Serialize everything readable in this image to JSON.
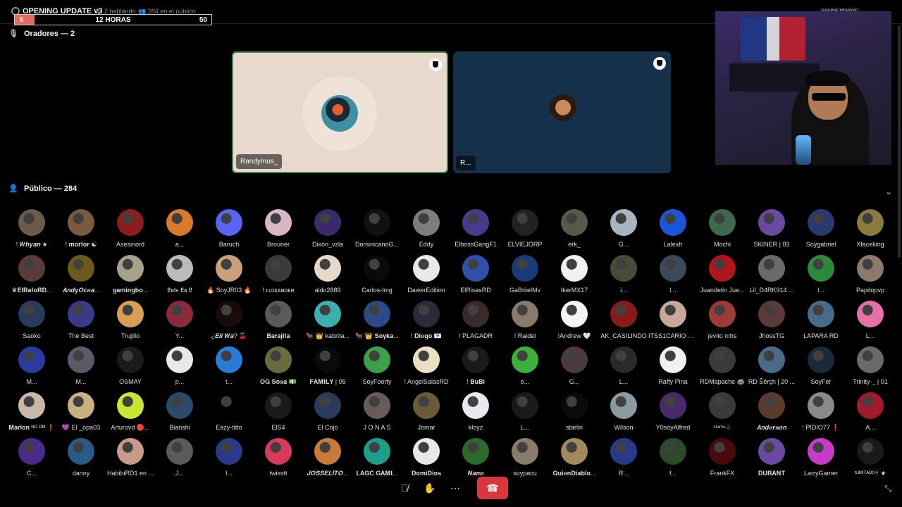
{
  "stage": {
    "title": "OPENING UPDATE v3",
    "speaking": "2 hablando",
    "audience_count_text": "284 en el público",
    "badge": "HABILITADO"
  },
  "timer": {
    "left_value": "5",
    "label": "12 HORAS",
    "right_value": "50",
    "progress": 0.1,
    "fill_color": "#e36a5f"
  },
  "speakers": {
    "heading": "Oradores — 2",
    "cards": [
      {
        "name": "Randymus_",
        "bg": "#e9d8cd"
      },
      {
        "name": "R...",
        "bg": "#15304a"
      }
    ]
  },
  "audience": {
    "heading": "Público — 284",
    "members": [
      {
        "name": "! 𝑾𝒉𝒚𝒂𝒏 ★",
        "color": "#6b5b4a"
      },
      {
        "name": "! 𝐦𝐨𝐫𝐟𝐨𝐫 ☯",
        "color": "#7a5a3c"
      },
      {
        "name": "Asesinord",
        "color": "#8a1d1d"
      },
      {
        "name": "a...",
        "color": "#d97a2b"
      },
      {
        "name": "Baruch",
        "color": "#5865f2"
      },
      {
        "name": "Brouner",
        "color": "#d8b6c8"
      },
      {
        "name": "Dixon_vzla",
        "color": "#3b2a6b"
      },
      {
        "name": "DominicanoG...",
        "color": "#111111"
      },
      {
        "name": "Eddy",
        "color": "#7d7d7d"
      },
      {
        "name": "ElbossGangF1",
        "color": "#4a3a8c"
      },
      {
        "name": "ELVIEJORP",
        "color": "#222222"
      },
      {
        "name": "erk_",
        "color": "#555a4a"
      },
      {
        "name": "G...",
        "color": "#aab4c0"
      },
      {
        "name": "Lalexh",
        "color": "#1a57d8"
      },
      {
        "name": "Mochi",
        "color": "#3d6a4c"
      },
      {
        "name": "SKINER | 03",
        "color": "#6a4aa0"
      },
      {
        "name": "Soygabriel",
        "color": "#2a3a6e"
      },
      {
        "name": "Xfaceking",
        "color": "#8a7a3c"
      },
      {
        "name": "♛𝐄𝐥𝐑𝐚𝐭𝐨𝐑𝐃...",
        "color": "#5a3a3a"
      },
      {
        "name": "𝑨𝒏𝒅𝒚𝑶𝒄𝒆𝒂...",
        "color": "#6b5a1a"
      },
      {
        "name": "𝐠𝐚𝐦𝐢𝐧𝐠𝐛𝐨...",
        "color": "#a7a08a"
      },
      {
        "name": "𝕷𝖚𝖎𝖘 𝕷𝖆 𝕷",
        "color": "#bbbbbb"
      },
      {
        "name": "🔥 SoyJR03 🔥",
        "color": "#c9a07a"
      },
      {
        "name": "! ʟᴜɪꜱᴀɴᴅᴇʀ",
        "color": "#3a3a3a"
      },
      {
        "name": "aldo2889",
        "color": "#e6d8c8"
      },
      {
        "name": "Carlos-lmg",
        "color": "#0a0a0a"
      },
      {
        "name": "DawerEdition",
        "color": "#e8e8e8"
      },
      {
        "name": "ElRisasRD",
        "color": "#2f4fa8"
      },
      {
        "name": "GaBriielMv",
        "color": "#1a3a7a"
      },
      {
        "name": "IkerMX17",
        "color": "#f0f0f0"
      },
      {
        "name": "i...",
        "color": "#4a4a3a"
      },
      {
        "name": "l...",
        "color": "#3a4a5a"
      },
      {
        "name": "Juandelin Jue...",
        "color": "#b0151a"
      },
      {
        "name": "Lil_D4RK914 ...",
        "color": "#6a6a6a"
      },
      {
        "name": "l...",
        "color": "#2a8a3a"
      },
      {
        "name": "Papitopvp",
        "color": "#8a7a6a"
      },
      {
        "name": "Saoko",
        "color": "#2a3a5a"
      },
      {
        "name": "The Best",
        "color": "#3a3a8a"
      },
      {
        "name": "Trujillo",
        "color": "#d8a050"
      },
      {
        "name": "Y...",
        "color": "#8a2a3a"
      },
      {
        "name": "¿𝑬𝒍𝒊 𝑾𝒂? 🍒",
        "color": "#1a0a0a"
      },
      {
        "name": "𝐁𝐚𝐫𝐚𝐣𝐢𝐭𝐚",
        "color": "#5a5a5a"
      },
      {
        "name": "🐂 👑 kabrita...",
        "color": "#3ab0b0"
      },
      {
        "name": "🐂 👑 𝐒𝐨𝐲𝐤𝐚...",
        "color": "#2a4a8a"
      },
      {
        "name": "! 𝐃𝐢𝐞𝐠𝐨 💌",
        "color": "#2a2a3a"
      },
      {
        "name": "! PLAGADR",
        "color": "#3a2a2a"
      },
      {
        "name": "! Raidel",
        "color": "#8a7a6a"
      },
      {
        "name": "!Andrew 🤍",
        "color": "#f4f4f4"
      },
      {
        "name": "AK_CASILINDO",
        "color": "#8a1a1a"
      },
      {
        "name": "ITSS1CARIO O...",
        "color": "#c8a898"
      },
      {
        "name": "jevito mhs",
        "color": "#a03a3a"
      },
      {
        "name": "JhossTG",
        "color": "#5a3a3a"
      },
      {
        "name": "LAPARA RD",
        "color": "#4a6a8a"
      },
      {
        "name": "L...",
        "color": "#e870a8"
      },
      {
        "name": "M...",
        "color": "#2a3aa0"
      },
      {
        "name": "M...",
        "color": "#5a5a6a"
      },
      {
        "name": "OSMAY",
        "color": "#1a1a1a"
      },
      {
        "name": "p...",
        "color": "#e8e8e8"
      },
      {
        "name": "t...",
        "color": "#2a7ad8"
      },
      {
        "name": "𝐎𝐆 𝐒𝐨𝐬𝐚 💵",
        "color": "#6a6a3a"
      },
      {
        "name": "𝐅𝐀𝐌𝐈𝐋𝐘 | 05",
        "color": "#0a0a0a"
      },
      {
        "name": "SoyFoorty",
        "color": "#3aa04a"
      },
      {
        "name": "! AngelSalasRD",
        "color": "#e8e0c0"
      },
      {
        "name": "! 𝐁𝐮𝐁𝐢",
        "color": "#1a1a1a"
      },
      {
        "name": "e...",
        "color": "#3ab03a"
      },
      {
        "name": "G...",
        "color": "#4a3a3a"
      },
      {
        "name": "L...",
        "color": "#2a2a2a"
      },
      {
        "name": "Raffy Pina",
        "color": "#f0f0f0"
      },
      {
        "name": "RDMapache 🦝",
        "color": "#3a3a3a"
      },
      {
        "name": "RD Šêrçh | 20 ...",
        "color": "#4a6a8a"
      },
      {
        "name": "SoyFer",
        "color": "#1a2a3a"
      },
      {
        "name": "Trinity-_ | 01",
        "color": "#6a6a6a"
      },
      {
        "name": "𝐌𝐚𝐫𝐥𝐨𝐧 ᴺᴼ ᴰᴹ ❗",
        "color": "#c8b8a8"
      },
      {
        "name": "💜 El _opa03",
        "color": "#c8b080"
      },
      {
        "name": "Arturovd 🔴...",
        "color": "#c8e830"
      },
      {
        "name": "Bianshi",
        "color": "#2a4a6a"
      },
      {
        "name": "Eazy-titto",
        "color": "#000000"
      },
      {
        "name": "ElS4",
        "color": "#1a1a1a"
      },
      {
        "name": "El Cojo",
        "color": "#2a3a5a"
      },
      {
        "name": "J O N A S",
        "color": "#6a5a5a"
      },
      {
        "name": "Jomar",
        "color": "#6a5a3a"
      },
      {
        "name": "kloyz",
        "color": "#e8e8f0"
      },
      {
        "name": "L...",
        "color": "#1a1a1a"
      },
      {
        "name": "starlin",
        "color": "#0a0a0a"
      },
      {
        "name": "Wilson",
        "color": "#8a9aa0"
      },
      {
        "name": "Y0soyAlfred",
        "color": "#4a2a6a"
      },
      {
        "name": "ˢᵗᵃʳˡⁱⁿ☆",
        "color": "#3a3a3a"
      },
      {
        "name": "𝑨𝒏𝒅𝒆𝒓𝒔𝒐𝒏",
        "color": "#5a3a2a"
      },
      {
        "name": "! PIDIO77 ❗",
        "color": "#8a8a8a"
      },
      {
        "name": "A...",
        "color": "#a01a2a"
      },
      {
        "name": "C...",
        "color": "#4a2a8a"
      },
      {
        "name": "danny",
        "color": "#2a5a8a"
      },
      {
        "name": "HabibiRD1 en ...",
        "color": "#c89a8a"
      },
      {
        "name": "J...",
        "color": "#5a5a5a"
      },
      {
        "name": "l...",
        "color": "#2a3a8a"
      },
      {
        "name": "twisstt",
        "color": "#d83a5a"
      },
      {
        "name": "𝑱𝑶𝑺𝑺𝑬𝑳𝑰𝑻𝑶...",
        "color": "#c87a3a"
      },
      {
        "name": "𝐋𝐀𝐆𝐂 𝐆𝐀𝐌𝐈...",
        "color": "#1aa08a"
      },
      {
        "name": "𝐃𝐨𝐦𝐢𝐃𝐢𝐨𝐬",
        "color": "#e8e8e8"
      },
      {
        "name": "𝑵𝒂𝒏𝒐",
        "color": "#2a6a2a"
      },
      {
        "name": "soypacu",
        "color": "#8a7a6a"
      },
      {
        "name": "𝐐𝐮𝐢𝐞𝐧𝐃𝐢𝐚𝐛𝐥𝐨...",
        "color": "#a08a5a"
      },
      {
        "name": "R...",
        "color": "#2a3a8a"
      },
      {
        "name": "f...",
        "color": "#2a4a2a"
      },
      {
        "name": "FrankFX",
        "color": "#4a0a0a"
      },
      {
        "name": "𝐃𝐔𝐑𝐀𝐍𝐓",
        "color": "#6a4aa0"
      },
      {
        "name": "LarryGamer",
        "color": "#c83ac8"
      },
      {
        "name": "ᵗᴸᴵᴹᴵᵀᴬᴰᴼ† ★",
        "color": "#1a1a1a"
      }
    ]
  },
  "toolbar": {
    "mute_icon": "mic-muted-icon",
    "hand_icon": "raise-hand-icon",
    "more_icon": "more-icon",
    "leave_icon": "hang-up-icon",
    "leave_color": "#da373c"
  }
}
